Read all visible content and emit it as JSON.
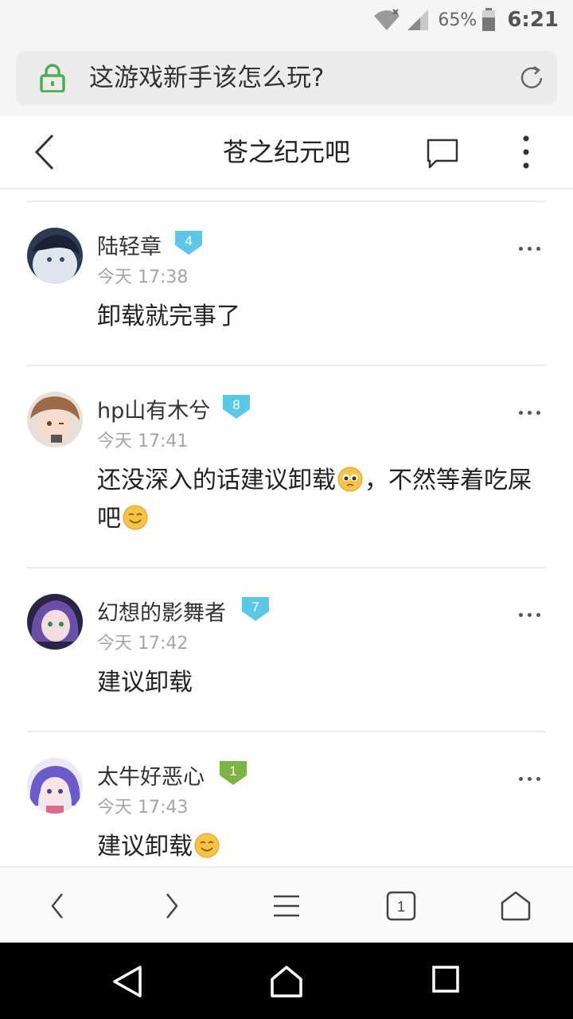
{
  "status": {
    "battery_pct": "65%",
    "time": "6:21"
  },
  "browser": {
    "url_text": "这游戏新手该怎么玩?"
  },
  "header": {
    "title": "苍之纪元吧"
  },
  "posts": [
    {
      "username": "陆轻章",
      "level": "4",
      "level_color": "#5bc8e8",
      "time": "今天 17:38",
      "content": "卸载就完事了"
    },
    {
      "username": "hp山有木兮",
      "level": "8",
      "level_color": "#5bc8e8",
      "time": "今天 17:41",
      "content_a": "还没深入的话建议卸载",
      "content_b": "，不然等着吃屎吧"
    },
    {
      "username": "幻想的影舞者",
      "level": "7",
      "level_color": "#5bc8e8",
      "time": "今天 17:42",
      "content": "建议卸载"
    },
    {
      "username": "太牛好恶心",
      "level": "1",
      "level_color": "#7cb342",
      "time": "今天 17:43",
      "content": "建议卸载"
    }
  ],
  "toolbar": {
    "tab_count": "1"
  }
}
